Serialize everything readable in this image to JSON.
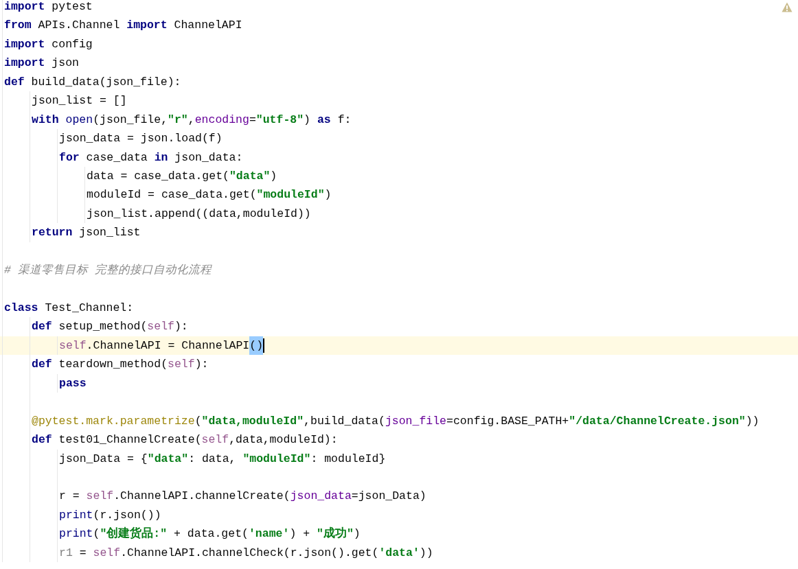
{
  "editor": {
    "warning": true,
    "lines": [
      {
        "kind": "code",
        "current": false,
        "tokens": [
          {
            "kind": "kw",
            "t": "import"
          },
          {
            "kind": "plain",
            "t": " pytest"
          }
        ]
      },
      {
        "kind": "code",
        "current": false,
        "tokens": [
          {
            "kind": "kw",
            "t": "from"
          },
          {
            "kind": "plain",
            "t": " APIs.Channel "
          },
          {
            "kind": "kw",
            "t": "import"
          },
          {
            "kind": "plain",
            "t": " ChannelAPI"
          }
        ]
      },
      {
        "kind": "code",
        "current": false,
        "tokens": [
          {
            "kind": "kw",
            "t": "import"
          },
          {
            "kind": "plain",
            "t": " config"
          }
        ]
      },
      {
        "kind": "code",
        "current": false,
        "tokens": [
          {
            "kind": "kw",
            "t": "import"
          },
          {
            "kind": "plain",
            "t": " json"
          }
        ]
      },
      {
        "kind": "code",
        "current": false,
        "tokens": [
          {
            "kind": "kw",
            "t": "def"
          },
          {
            "kind": "plain",
            "t": " build_data(json_file):"
          }
        ],
        "children": [
          {
            "kind": "code",
            "current": false,
            "tokens": [
              {
                "kind": "plain",
                "t": "json_list = []"
              }
            ]
          },
          {
            "kind": "code",
            "current": false,
            "tokens": [
              {
                "kind": "kw",
                "t": "with"
              },
              {
                "kind": "builtin",
                "t": " open"
              },
              {
                "kind": "plain",
                "t": "(json_file,"
              },
              {
                "kind": "str",
                "t": "\"r\""
              },
              {
                "kind": "plain",
                "t": ","
              },
              {
                "kind": "param",
                "t": "encoding"
              },
              {
                "kind": "plain",
                "t": "="
              },
              {
                "kind": "str",
                "t": "\"utf-8\""
              },
              {
                "kind": "plain",
                "t": ") "
              },
              {
                "kind": "kw",
                "t": "as"
              },
              {
                "kind": "plain",
                "t": " f:"
              }
            ],
            "children": [
              {
                "kind": "code",
                "current": false,
                "tokens": [
                  {
                    "kind": "plain",
                    "t": "json_data = json.load(f)"
                  }
                ]
              },
              {
                "kind": "code",
                "current": false,
                "tokens": [
                  {
                    "kind": "kw",
                    "t": "for"
                  },
                  {
                    "kind": "plain",
                    "t": " case_data "
                  },
                  {
                    "kind": "kw",
                    "t": "in"
                  },
                  {
                    "kind": "plain",
                    "t": " json_data:"
                  }
                ],
                "children": [
                  {
                    "kind": "code",
                    "current": false,
                    "tokens": [
                      {
                        "kind": "plain",
                        "t": "data = case_data.get("
                      },
                      {
                        "kind": "str",
                        "t": "\"data\""
                      },
                      {
                        "kind": "plain",
                        "t": ")"
                      }
                    ]
                  },
                  {
                    "kind": "code",
                    "current": false,
                    "tokens": [
                      {
                        "kind": "plain",
                        "t": "moduleId = case_data.get("
                      },
                      {
                        "kind": "str",
                        "t": "\"moduleId\""
                      },
                      {
                        "kind": "plain",
                        "t": ")"
                      }
                    ]
                  },
                  {
                    "kind": "code",
                    "current": false,
                    "tokens": [
                      {
                        "kind": "plain",
                        "t": "json_list.append((data,moduleId))"
                      }
                    ]
                  }
                ]
              }
            ]
          },
          {
            "kind": "code",
            "current": false,
            "tokens": [
              {
                "kind": "kw",
                "t": "return"
              },
              {
                "kind": "plain",
                "t": " json_list"
              }
            ]
          }
        ]
      },
      {
        "kind": "blank"
      },
      {
        "kind": "code",
        "current": false,
        "tokens": [
          {
            "kind": "comment",
            "t": "# 渠道零售目标 完整的接口自动化流程"
          }
        ]
      },
      {
        "kind": "blank"
      },
      {
        "kind": "code",
        "current": false,
        "tokens": [
          {
            "kind": "kw",
            "t": "class"
          },
          {
            "kind": "plain",
            "t": " Test_Channel:"
          }
        ],
        "children": [
          {
            "kind": "code",
            "current": false,
            "tokens": [
              {
                "kind": "kw",
                "t": "def"
              },
              {
                "kind": "plain",
                "t": " setup_method("
              },
              {
                "kind": "self",
                "t": "self"
              },
              {
                "kind": "plain",
                "t": "):"
              }
            ],
            "children": [
              {
                "kind": "code",
                "current": true,
                "tokens": [
                  {
                    "kind": "self",
                    "t": "self"
                  },
                  {
                    "kind": "plain",
                    "t": ".ChannelAPI = ChannelAPI"
                  },
                  {
                    "kind": "match",
                    "t": "()"
                  }
                ]
              }
            ]
          },
          {
            "kind": "code",
            "current": false,
            "tokens": [
              {
                "kind": "kw",
                "t": "def"
              },
              {
                "kind": "plain",
                "t": " teardown_method("
              },
              {
                "kind": "self",
                "t": "self"
              },
              {
                "kind": "plain",
                "t": "):"
              }
            ],
            "children": [
              {
                "kind": "code",
                "current": false,
                "tokens": [
                  {
                    "kind": "kw",
                    "t": "pass"
                  }
                ]
              }
            ]
          },
          {
            "kind": "blank"
          },
          {
            "kind": "code",
            "current": false,
            "tokens": [
              {
                "kind": "deco",
                "t": "@pytest.mark.parametrize"
              },
              {
                "kind": "plain",
                "t": "("
              },
              {
                "kind": "str",
                "t": "\"data,moduleId\""
              },
              {
                "kind": "plain",
                "t": ",build_data("
              },
              {
                "kind": "param",
                "t": "json_file"
              },
              {
                "kind": "plain",
                "t": "=config.BASE_PATH+"
              },
              {
                "kind": "str",
                "t": "\"/data/ChannelCreate.json\""
              },
              {
                "kind": "plain",
                "t": "))"
              }
            ]
          },
          {
            "kind": "code",
            "current": false,
            "tokens": [
              {
                "kind": "kw",
                "t": "def"
              },
              {
                "kind": "plain",
                "t": " test01_ChannelCreate("
              },
              {
                "kind": "self",
                "t": "self"
              },
              {
                "kind": "plain",
                "t": ",data,moduleId):"
              }
            ],
            "children": [
              {
                "kind": "code",
                "current": false,
                "tokens": [
                  {
                    "kind": "plain",
                    "t": "json_Data = {"
                  },
                  {
                    "kind": "str",
                    "t": "\"data\""
                  },
                  {
                    "kind": "plain",
                    "t": ": data, "
                  },
                  {
                    "kind": "str",
                    "t": "\"moduleId\""
                  },
                  {
                    "kind": "plain",
                    "t": ": moduleId}"
                  }
                ]
              },
              {
                "kind": "blank"
              },
              {
                "kind": "code",
                "current": false,
                "tokens": [
                  {
                    "kind": "plain",
                    "t": "r = "
                  },
                  {
                    "kind": "self",
                    "t": "self"
                  },
                  {
                    "kind": "plain",
                    "t": ".ChannelAPI.channelCreate("
                  },
                  {
                    "kind": "param",
                    "t": "json_data"
                  },
                  {
                    "kind": "plain",
                    "t": "=json_Data)"
                  }
                ]
              },
              {
                "kind": "code",
                "current": false,
                "tokens": [
                  {
                    "kind": "builtin",
                    "t": "print"
                  },
                  {
                    "kind": "plain",
                    "t": "(r.json())"
                  }
                ]
              },
              {
                "kind": "code",
                "current": false,
                "tokens": [
                  {
                    "kind": "builtin",
                    "t": "print"
                  },
                  {
                    "kind": "plain",
                    "t": "("
                  },
                  {
                    "kind": "str",
                    "t": "\"创建货品:\""
                  },
                  {
                    "kind": "plain",
                    "t": " + data.get("
                  },
                  {
                    "kind": "str",
                    "t": "'name'"
                  },
                  {
                    "kind": "plain",
                    "t": ") + "
                  },
                  {
                    "kind": "str",
                    "t": "\"成功\""
                  },
                  {
                    "kind": "plain",
                    "t": ")"
                  }
                ]
              },
              {
                "kind": "code",
                "current": false,
                "tokens": [
                  {
                    "kind": "unused",
                    "t": "r1"
                  },
                  {
                    "kind": "plain",
                    "t": " = "
                  },
                  {
                    "kind": "self",
                    "t": "self"
                  },
                  {
                    "kind": "plain",
                    "t": ".ChannelAPI.channelCheck(r.json().get("
                  },
                  {
                    "kind": "str",
                    "t": "'data'"
                  },
                  {
                    "kind": "plain",
                    "t": "))"
                  }
                ]
              }
            ]
          }
        ]
      }
    ]
  }
}
